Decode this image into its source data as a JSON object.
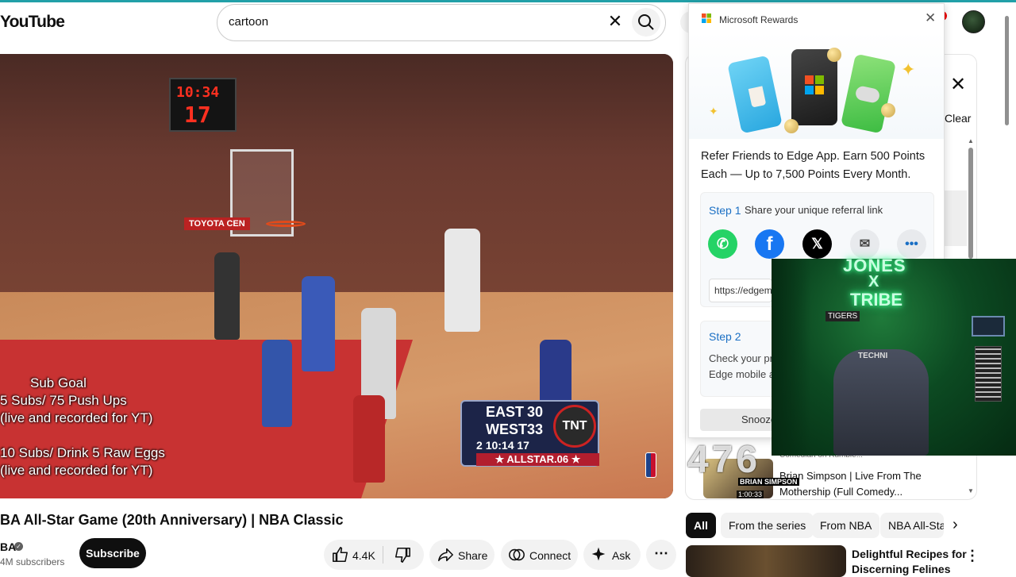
{
  "header": {
    "logo": "YouTube",
    "search_value": "cartoon",
    "clear_icon": "close-icon",
    "search_icon": "search-icon"
  },
  "video": {
    "shotclock_time": "10:34",
    "shotclock_seconds": "17",
    "arena_sign": "TOYOTA CEN",
    "overlay": {
      "sub_goal": "Sub Goal",
      "goal1_line1": "5 Subs/ 75 Push Ups",
      "goal1_line2": "(live and recorded for YT)",
      "goal2_line1": "10 Subs/ Drink 5 Raw Eggs",
      "goal2_line2": "(live and recorded for YT)"
    },
    "scorebug": {
      "east_name": "EAST",
      "east_score": "30",
      "west_name": "WEST",
      "west_score": "33",
      "quarter": "2",
      "clock": "10:14",
      "shot": "17",
      "network": "TNT",
      "banner": "★ ALLSTAR.06 ★"
    }
  },
  "meta": {
    "title": "BA All-Star Game (20th Anniversary) | NBA Classic",
    "channel": "BA",
    "subscribers": "4M subscribers",
    "subscribe_label": "Subscribe",
    "like_count": "4.4K",
    "share_label": "Share",
    "connect_label": "Connect",
    "ask_label": "Ask"
  },
  "sidebar": {
    "clear_label": "Clear",
    "playlist_item": {
      "title_line1": "Brian Simpson | Live From The",
      "title_line2": "Mothership (Full Comedy...",
      "partial_line": "Comedian on Rumble...",
      "thumb_label": "BRIAN SIMPSON",
      "duration": "1:00:33"
    },
    "chips": [
      "All",
      "From the series",
      "From NBA",
      "NBA All-Sta"
    ],
    "recommended": {
      "title_line1": "Delightful Recipes for",
      "title_line2": "Discerning Felines"
    }
  },
  "rewards": {
    "title": "Microsoft Rewards",
    "refer_line1": "Refer Friends to Edge App. Earn 500 Points",
    "refer_line2": "Each — Up to 7,500 Points Every Month.",
    "step1_label": "Step 1",
    "step1_text": "Share your unique referral link",
    "link_value": "https://edgem",
    "step2_label": "Step 2",
    "step2_text1": "Check your pr",
    "step2_text2": "Edge mobile a",
    "snooze_label": "Snooze",
    "share_icons": [
      "whatsapp-icon",
      "facebook-icon",
      "x-icon",
      "mail-icon",
      "more-icon"
    ]
  },
  "webcam": {
    "neon_line1": "JONES",
    "neon_line2": "X",
    "neon_line3": "TRIBE",
    "chair_brand": "TECHNI",
    "sign": "TIGERS",
    "ghost_text": "476"
  },
  "colors": {
    "youtube_red": "#ff0000",
    "subscribe_bg": "#0f0f0f",
    "rewards_link": "#1a6fc4",
    "neon_green": "#3cff90"
  }
}
